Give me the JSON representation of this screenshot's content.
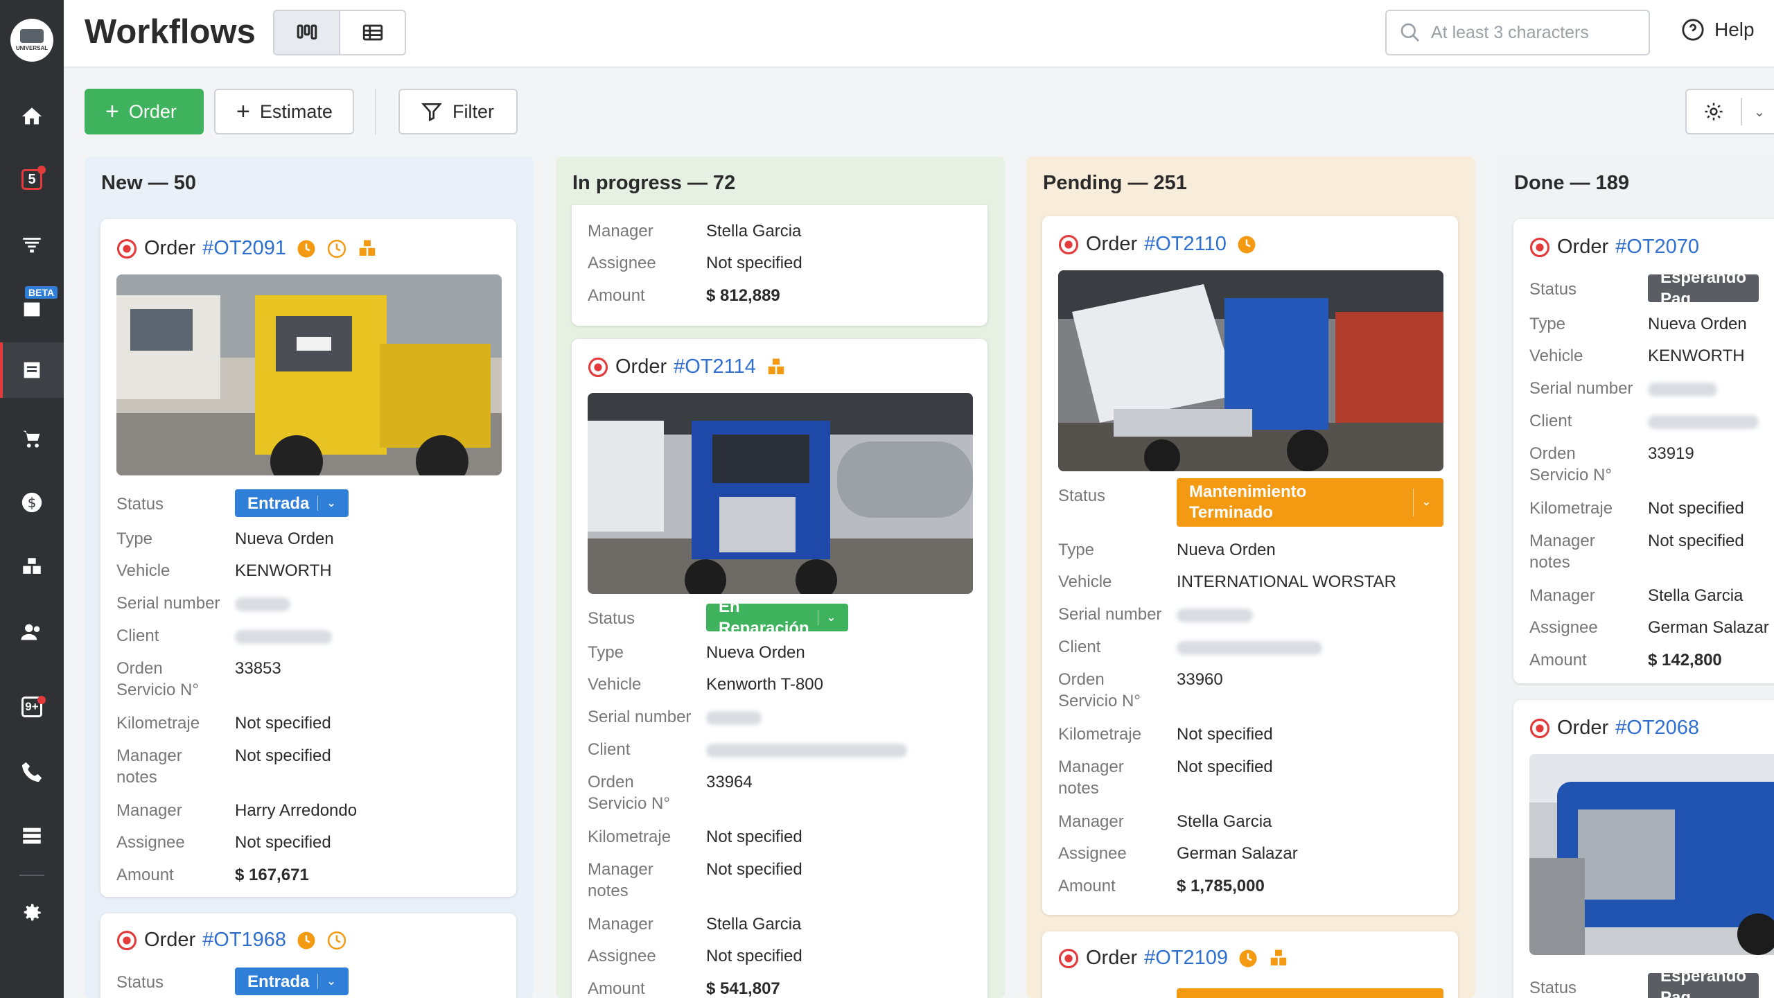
{
  "app": {
    "logo_text": "UNIVERSAL",
    "rail": {
      "badge_5": "5",
      "beta_label": "BETA",
      "badge_9plus": "9+"
    }
  },
  "header": {
    "title": "Workflows",
    "search_placeholder": "At least 3 characters",
    "help_label": "Help"
  },
  "toolbar": {
    "order_label": "Order",
    "estimate_label": "Estimate",
    "filter_label": "Filter"
  },
  "field_labels": {
    "status": "Status",
    "type": "Type",
    "vehicle": "Vehicle",
    "serial": "Serial number",
    "client": "Client",
    "orden_servicio_1": "Orden",
    "orden_servicio_2": "Servicio N°",
    "kilometraje": "Kilometraje",
    "manager_notes_1": "Manager",
    "manager_notes_2": "notes",
    "manager": "Manager",
    "assignee": "Assignee",
    "amount": "Amount"
  },
  "order_prefix": "Order",
  "columns": {
    "new": {
      "title": "New — 50",
      "cards": [
        {
          "number": "#OT2091",
          "status": "Entrada",
          "type": "Nueva Orden",
          "vehicle": "KENWORTH",
          "orden_servicio": "33853",
          "kilometraje": "Not specified",
          "manager_notes": "Not specified",
          "manager": "Harry Arredondo",
          "assignee": "Not specified",
          "amount": "$ 167,671"
        },
        {
          "number": "#OT1968",
          "status": "Entrada"
        }
      ]
    },
    "in_progress": {
      "title": "In progress — 72",
      "partial": {
        "manager": "Stella Garcia",
        "assignee": "Not specified",
        "amount": "$ 812,889"
      },
      "cards": [
        {
          "number": "#OT2114",
          "status": "En Reparación",
          "type": "Nueva Orden",
          "vehicle": "Kenworth T-800",
          "orden_servicio": "33964",
          "kilometraje": "Not specified",
          "manager_notes": "Not specified",
          "manager": "Stella Garcia",
          "assignee": "Not specified",
          "amount": "$ 541,807"
        }
      ]
    },
    "pending": {
      "title": "Pending — 251",
      "cards": [
        {
          "number": "#OT2110",
          "status_line1": "Mantenimiento",
          "status_line2": "Terminado",
          "type": "Nueva Orden",
          "vehicle": "INTERNATIONAL WORSTAR",
          "orden_servicio": "33960",
          "kilometraje": "Not specified",
          "manager_notes": "Not specified",
          "manager": "Stella Garcia",
          "assignee": "German Salazar",
          "amount": "$ 1,785,000"
        },
        {
          "number": "#OT2109"
        }
      ]
    },
    "done": {
      "title": "Done — 189",
      "cards": [
        {
          "number": "#OT2070",
          "status": "Esperando Pag",
          "type": "Nueva Orden",
          "vehicle": "KENWORTH",
          "orden_servicio": "33919",
          "kilometraje": "Not specified",
          "manager_notes": "Not specified",
          "manager": "Stella Garcia",
          "assignee": "German Salazar",
          "amount": "$ 142,800"
        },
        {
          "number": "#OT2068",
          "status": "Esperando Pag"
        }
      ]
    }
  },
  "colors": {
    "accent_green": "#3fb25d",
    "status_blue": "#2f7fd8",
    "status_orange": "#f39a12",
    "link_blue": "#2f6fd0",
    "alert_red": "#e33b3b"
  }
}
